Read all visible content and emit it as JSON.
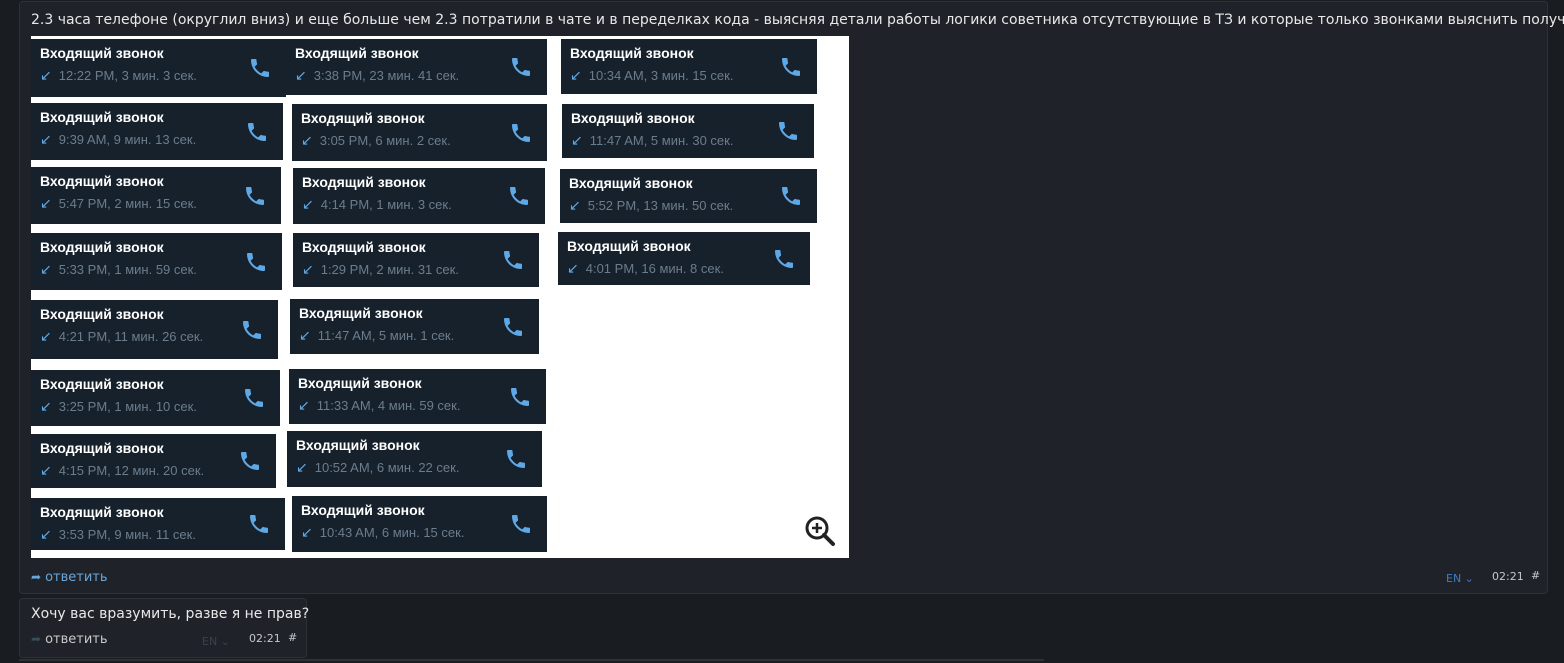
{
  "messages": [
    {
      "text": "2.3 часа телефоне (округлил вниз) и еще больше чем 2.3 потратили в чате и в переделках кода - выясняя детали работы логики советника отсутствующие в ТЗ и которые только звонками выяснить получилось.",
      "reply_label": "ответить",
      "lang": "EN",
      "time": "02:21",
      "hash": "#"
    },
    {
      "text": "Хочу вас вразумить, разве я не прав?",
      "reply_label": "ответить",
      "lang": "EN",
      "time": "02:21",
      "hash": "#"
    }
  ],
  "call_title": "Входящий звонок",
  "calls": {
    "col1": [
      "12:22 PM, 3 мин. 3 сек.",
      "9:39 AM, 9 мин. 13 сек.",
      "5:47 PM, 2 мин. 15 сек.",
      "5:33 PM, 1 мин. 59 сек.",
      "4:21 PM, 11 мин. 26 сек.",
      "3:25 PM, 1 мин. 10 сек.",
      "4:15 PM, 12 мин. 20 сек.",
      "3:53 PM, 9 мин. 11 сек."
    ],
    "col2": [
      "3:38 PM, 23 мин. 41 сек.",
      "3:05 PM, 6 мин. 2 сек.",
      "4:14 PM, 1 мин. 3 сек.",
      "1:29 PM, 2 мин. 31 сек.",
      "11:47 AM, 5 мин. 1 сек.",
      "11:33 AM, 4 мин. 59 сек.",
      "10:52 AM, 6 мин. 22 сек.",
      "10:43 AM, 6 мин. 15 сек."
    ],
    "col3": [
      "10:34 AM, 3 мин. 15 сек.",
      "11:47 AM, 5 мин. 30 сек.",
      "5:52 PM, 13 мин. 50 сек.",
      "4:01 PM, 16 мин. 8 сек."
    ]
  },
  "icons": {
    "call": "phone-icon",
    "incoming": "incoming-arrow-icon",
    "zoom": "zoom-in-icon",
    "reply": "reply-icon"
  },
  "colors": {
    "card_bg": "#17212b",
    "accent": "#5fa8e6",
    "page_bg": "#191c20"
  }
}
